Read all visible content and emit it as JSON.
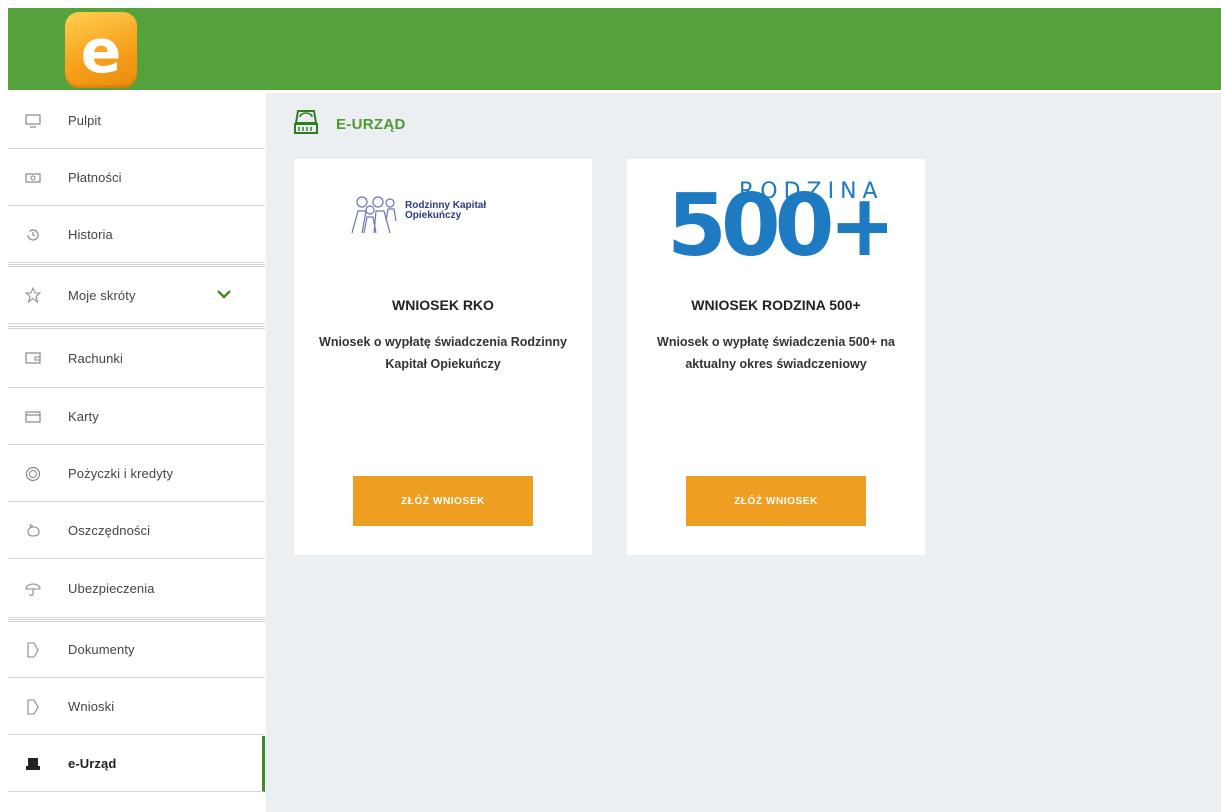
{
  "app": {
    "logo_letter": "e",
    "brand_color": "#55a23c",
    "accent_color": "#ee9f22"
  },
  "sidebar": {
    "items": [
      {
        "label": "Pulpit",
        "icon": "monitor-icon"
      },
      {
        "label": "Płatności",
        "icon": "banknote-icon"
      },
      {
        "label": "Historia",
        "icon": "history-icon"
      },
      {
        "label": "Moje skróty",
        "icon": "star-icon"
      },
      {
        "label": "Rachunki",
        "icon": "wallet-icon"
      },
      {
        "label": "Karty",
        "icon": "card-icon"
      },
      {
        "label": "Pożyczki i kredyty",
        "icon": "coin-icon"
      },
      {
        "label": "Oszczędności",
        "icon": "piggy-bank-icon"
      },
      {
        "label": "Ubezpieczenia",
        "icon": "umbrella-icon"
      },
      {
        "label": "Dokumenty",
        "icon": "document-icon"
      },
      {
        "label": "Wnioski",
        "icon": "document-icon"
      },
      {
        "label": "e-Urząd",
        "icon": "e-office-icon",
        "active": true
      }
    ]
  },
  "main": {
    "section_title": "E-URZĄD",
    "cards": [
      {
        "logo_text_line1": "Rodzinny Kapitał",
        "logo_text_line2": "Opiekuńczy",
        "title": "WNIOSEK RKO",
        "description": "Wniosek o wypłatę świadczenia Rodzinny Kapitał Opiekuńczy",
        "button_label": "ZŁÓŻ WNIOSEK"
      },
      {
        "logo_word": "RODZINA",
        "logo_number": "500+",
        "title": "WNIOSEK RODZINA 500+",
        "description": "Wniosek o wypłatę świadczenia 500+ na aktualny okres świadczeniowy",
        "button_label": "ZŁÓŻ WNIOSEK"
      }
    ]
  }
}
